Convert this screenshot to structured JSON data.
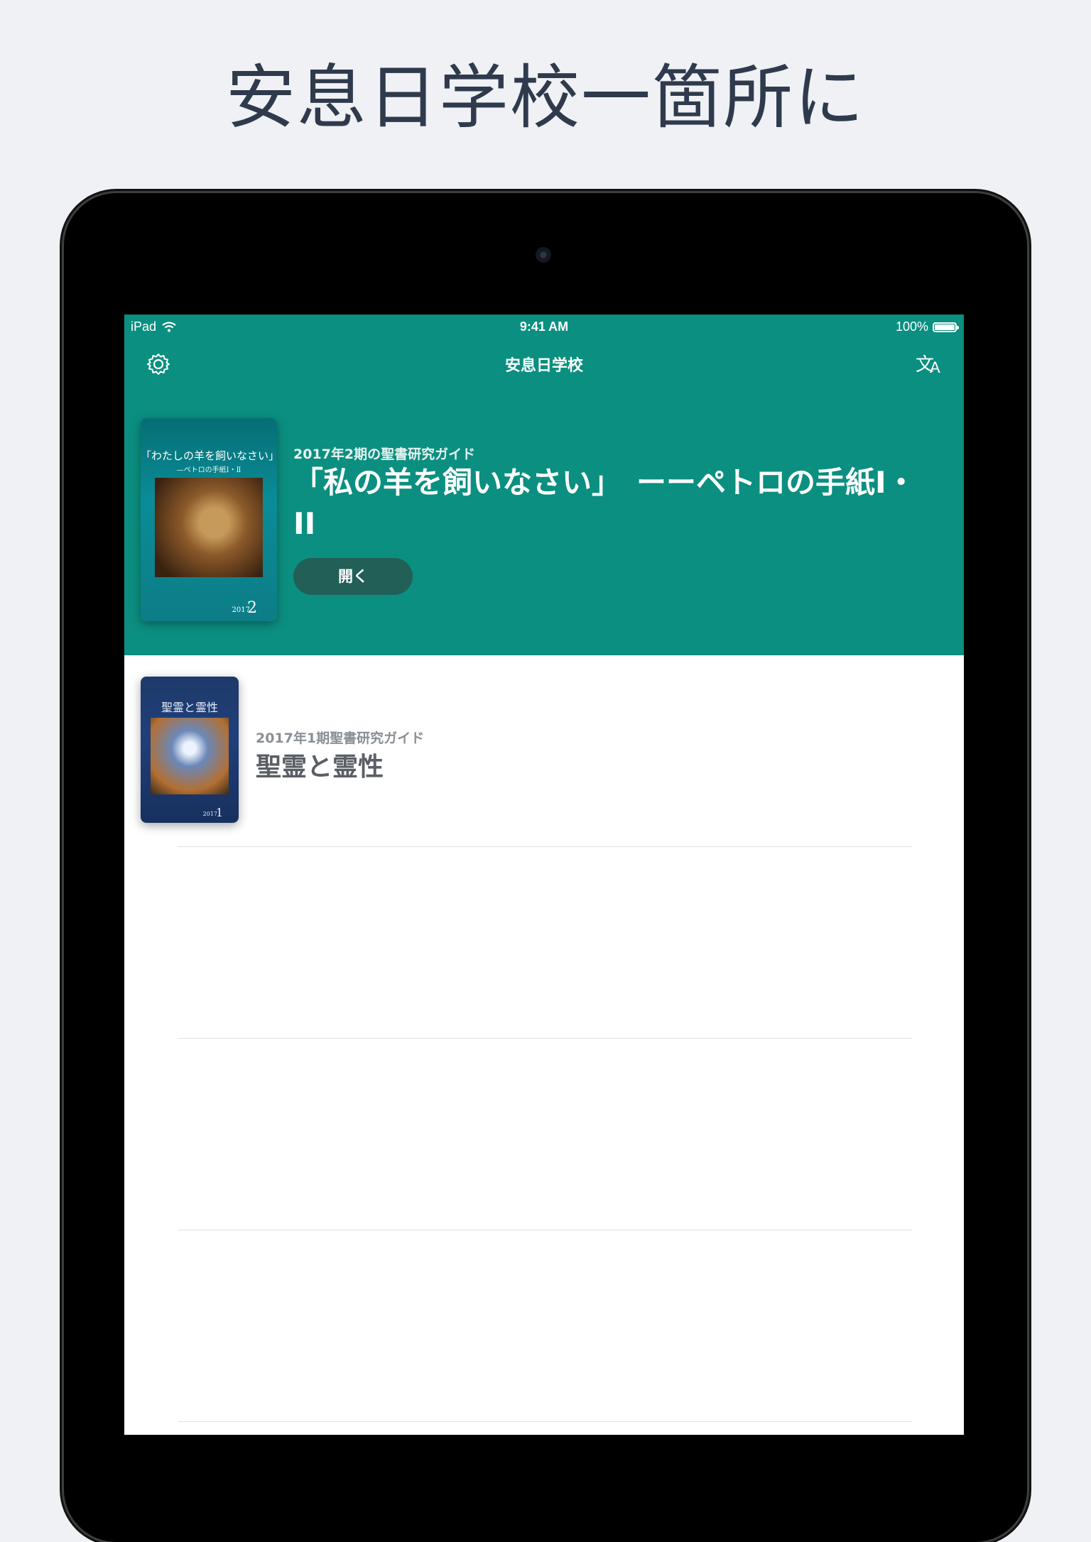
{
  "headline": "安息日学校一箇所に",
  "status_bar": {
    "device": "iPad",
    "time": "9:41 AM",
    "battery": "100%"
  },
  "nav": {
    "title": "安息日学校"
  },
  "featured": {
    "subtitle": "2017年2期の聖書研究ガイド",
    "title": "「私の羊を飼いなさい」　ーーペトロの手紙I・II",
    "open_label": "開く",
    "cover": {
      "title": "「わたしの羊を飼いなさい」",
      "subtitle": "—ペトロの手紙Ⅰ・Ⅱ",
      "year": "2017",
      "quarter": "2"
    }
  },
  "list": [
    {
      "subtitle": "2017年1期聖書研究ガイド",
      "title": "聖霊と霊性",
      "cover": {
        "title": "聖霊と霊性",
        "year": "2017",
        "quarter": "1"
      }
    }
  ],
  "colors": {
    "teal": "#0b8f80",
    "button": "#225f56",
    "background": "#eff1f4"
  }
}
